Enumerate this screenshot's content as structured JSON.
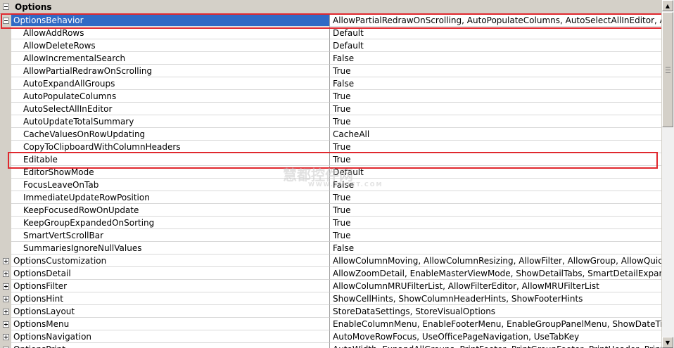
{
  "category": {
    "label": "Options",
    "expander": "minus"
  },
  "rows": [
    {
      "name": "OptionsBehavior",
      "value": "AllowPartialRedrawOnScrolling, AutoPopulateColumns, AutoSelectAllInEditor, AutoUpd",
      "level": 0,
      "expander": "minus",
      "selected": true
    },
    {
      "name": "AllowAddRows",
      "value": "Default",
      "level": 1
    },
    {
      "name": "AllowDeleteRows",
      "value": "Default",
      "level": 1
    },
    {
      "name": "AllowIncrementalSearch",
      "value": "False",
      "level": 1
    },
    {
      "name": "AllowPartialRedrawOnScrolling",
      "value": "True",
      "level": 1
    },
    {
      "name": "AutoExpandAllGroups",
      "value": "False",
      "level": 1
    },
    {
      "name": "AutoPopulateColumns",
      "value": "True",
      "level": 1
    },
    {
      "name": "AutoSelectAllInEditor",
      "value": "True",
      "level": 1
    },
    {
      "name": "AutoUpdateTotalSummary",
      "value": "True",
      "level": 1
    },
    {
      "name": "CacheValuesOnRowUpdating",
      "value": "CacheAll",
      "level": 1
    },
    {
      "name": "CopyToClipboardWithColumnHeaders",
      "value": "True",
      "level": 1
    },
    {
      "name": "Editable",
      "value": "True",
      "level": 1
    },
    {
      "name": "EditorShowMode",
      "value": "Default",
      "level": 1
    },
    {
      "name": "FocusLeaveOnTab",
      "value": "False",
      "level": 1
    },
    {
      "name": "ImmediateUpdateRowPosition",
      "value": "True",
      "level": 1
    },
    {
      "name": "KeepFocusedRowOnUpdate",
      "value": "True",
      "level": 1
    },
    {
      "name": "KeepGroupExpandedOnSorting",
      "value": "True",
      "level": 1
    },
    {
      "name": "SmartVertScrollBar",
      "value": "True",
      "level": 1
    },
    {
      "name": "SummariesIgnoreNullValues",
      "value": "False",
      "level": 1
    },
    {
      "name": "OptionsCustomization",
      "value": "AllowColumnMoving, AllowColumnResizing, AllowFilter, AllowGroup, AllowQuickHideCol",
      "level": 0,
      "expander": "plus"
    },
    {
      "name": "OptionsDetail",
      "value": "AllowZoomDetail, EnableMasterViewMode, ShowDetailTabs, SmartDetailExpand",
      "level": 0,
      "expander": "plus"
    },
    {
      "name": "OptionsFilter",
      "value": "AllowColumnMRUFilterList, AllowFilterEditor, AllowMRUFilterList",
      "level": 0,
      "expander": "plus"
    },
    {
      "name": "OptionsHint",
      "value": "ShowCellHints, ShowColumnHeaderHints, ShowFooterHints",
      "level": 0,
      "expander": "plus"
    },
    {
      "name": "OptionsLayout",
      "value": "StoreDataSettings, StoreVisualOptions",
      "level": 0,
      "expander": "plus"
    },
    {
      "name": "OptionsMenu",
      "value": "EnableColumnMenu, EnableFooterMenu, EnableGroupPanelMenu, ShowDateTimeGrou",
      "level": 0,
      "expander": "plus"
    },
    {
      "name": "OptionsNavigation",
      "value": "AutoMoveRowFocus, UseOfficePageNavigation, UseTabKey",
      "level": 0,
      "expander": "plus"
    },
    {
      "name": "OptionsPrint",
      "value": "AutoWidth, ExpandAllGroups, PrintFooter, PrintGroupFooter, PrintHeader, PrintHorizLi",
      "level": 0,
      "expander": "plus"
    }
  ],
  "watermark": {
    "text": "慧都控件网",
    "sub": "WWW.EVGET.COM"
  },
  "colors": {
    "selection": "#316ac5",
    "callout": "#e0282e",
    "gutter": "#d4d0c8"
  },
  "scrollbar": {
    "up_icon": "triangle-up-icon",
    "down_icon": "triangle-down-icon"
  }
}
